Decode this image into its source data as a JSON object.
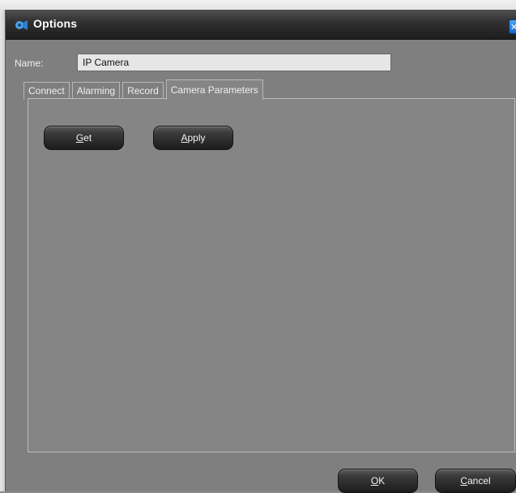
{
  "window": {
    "title": "Options"
  },
  "name_field": {
    "label": "Name:",
    "value": "IP Camera"
  },
  "tabs": [
    {
      "label": "Connect",
      "active": false
    },
    {
      "label": "Alarming",
      "active": false
    },
    {
      "label": "Record",
      "active": false
    },
    {
      "label": "Camera Parameters",
      "active": true
    }
  ],
  "panel_buttons": {
    "get": {
      "accel": "G",
      "rest": "et"
    },
    "apply": {
      "accel": "A",
      "rest": "pply"
    }
  },
  "dialog_buttons": {
    "ok": {
      "accel": "O",
      "rest": "K"
    },
    "cancel": {
      "accel": "C",
      "rest": "ancel"
    }
  },
  "colors": {
    "accent": "#1663c7",
    "background": "#7f7f7f",
    "title_bar": "#2f2f2f"
  },
  "icons": {
    "app": "camera-app-icon",
    "close": "close-icon"
  }
}
